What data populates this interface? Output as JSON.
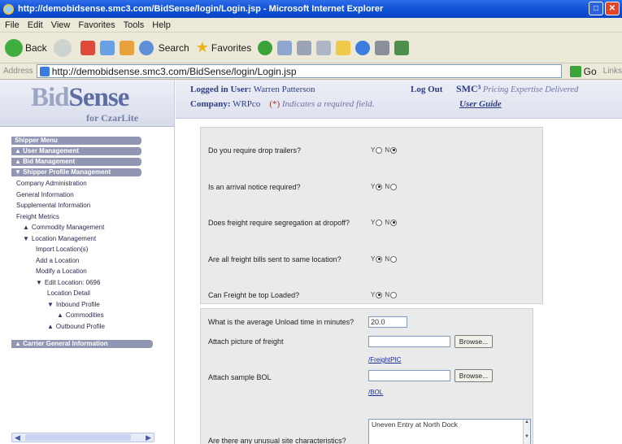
{
  "window": {
    "title": "http://demobidsense.smc3.com/BidSense/login/Login.jsp - Microsoft Internet Explorer"
  },
  "menu": [
    "File",
    "Edit",
    "View",
    "Favorites",
    "Tools",
    "Help"
  ],
  "toolbar": {
    "back": "Back",
    "search": "Search",
    "favorites": "Favorites"
  },
  "address": {
    "label": "Address",
    "url": "http://demobidsense.smc3.com/BidSense/login/Login.jsp",
    "go": "Go",
    "links": "Links"
  },
  "logo": {
    "brand_prefix": "Bid",
    "brand_suffix": "Sense",
    "sub": "for CzarLite"
  },
  "header": {
    "logged_in_label": "Logged in User:",
    "user": "Warren Patterson",
    "logout": "Log Out",
    "smc": "SMC³",
    "tagline": "Pricing Expertise Delivered",
    "company_label": "Company:",
    "company": "WRPco",
    "required_mark": "(*)",
    "required_text": "Indicates a required field.",
    "user_guide": "User Guide"
  },
  "sidebar": {
    "shipper_menu": "Shipper Menu",
    "user_management": "User Management",
    "bid_management": "Bid Management",
    "shipper_profile": "Shipper Profile Management",
    "items": [
      "Company Administration",
      "General Information",
      "Supplemental Information",
      "Freight Metrics",
      "Commodity Management",
      "Location Management",
      "Import Location(s)",
      "Add a Location",
      "Modify a Location",
      "Edit Location: 0696",
      "Location Detail",
      "Inbound Profile",
      "Commodities",
      "Outbound Profile"
    ],
    "carrier_info": "Carrier General Information"
  },
  "form": {
    "questions": [
      {
        "label": "Do you require drop trailers?",
        "yes": "Y",
        "no": "N",
        "selected": "N"
      },
      {
        "label": "Is an arrival notice required?",
        "yes": "Y",
        "no": "N",
        "selected": "Y"
      },
      {
        "label": "Does freight require segregation at dropoff?",
        "yes": "Y",
        "no": "N",
        "selected": "N"
      },
      {
        "label": "Are all freight bills sent to same location?",
        "yes": "Y",
        "no": "N",
        "selected": "Y"
      },
      {
        "label": "Can Freight be top Loaded?",
        "yes": "Y",
        "no": "N",
        "selected": "Y"
      }
    ],
    "unload_label": "What is the average Unload time in minutes?",
    "unload_value": "20.0",
    "attach_picture_label": "Attach picture of freight",
    "browse": "Browse...",
    "freight_link": "/FreightPIC",
    "attach_bol_label": "Attach sample BOL",
    "bol_link": "/BOL",
    "site_label": "Are there any unusual site characteristics?",
    "site_value": "Uneven Entry at North Dock"
  }
}
